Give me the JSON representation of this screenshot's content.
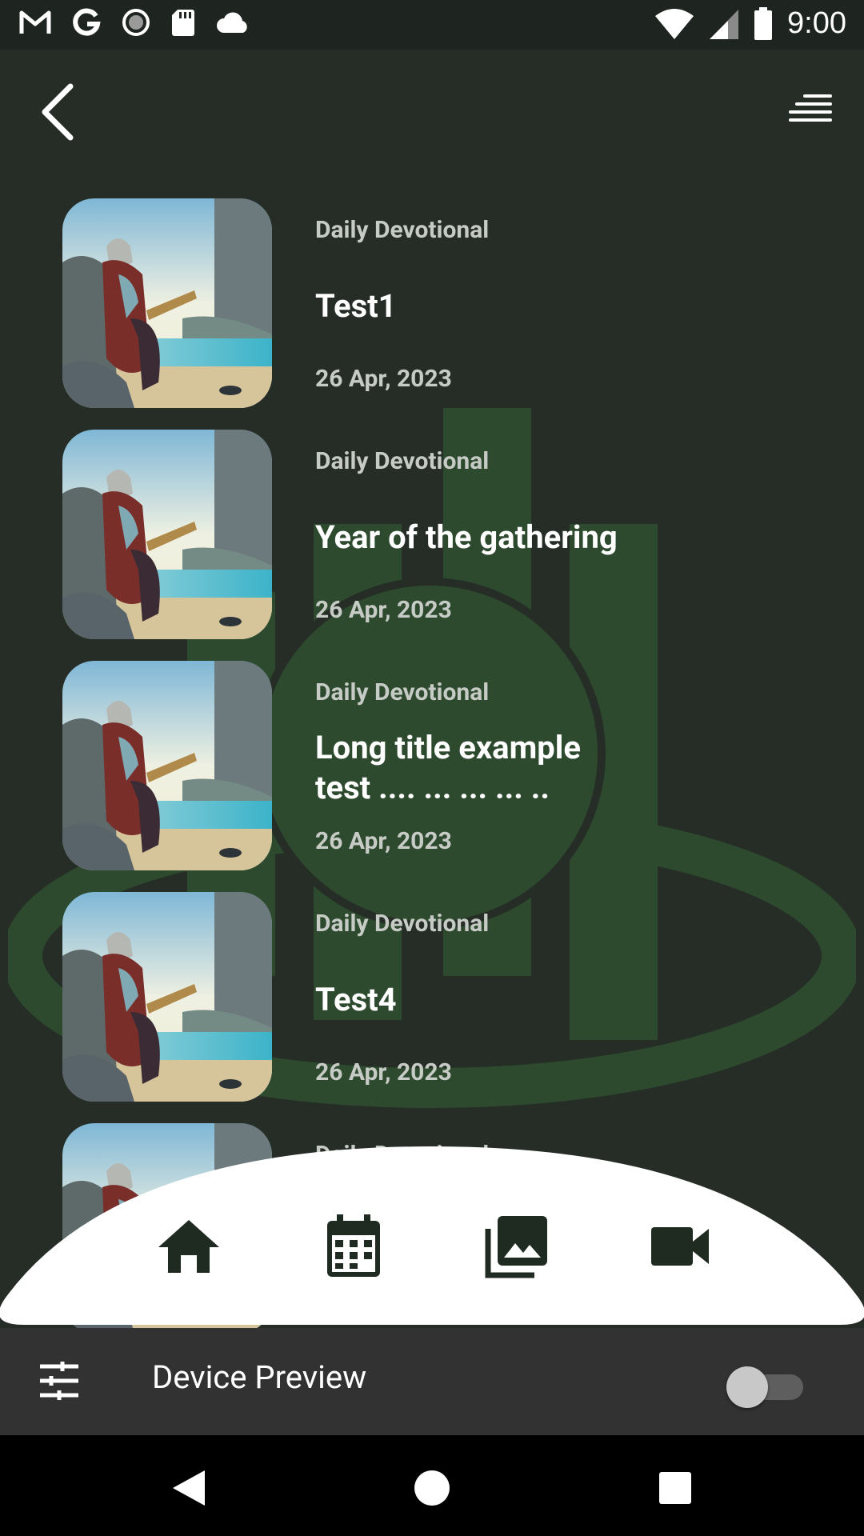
{
  "status_bar": {
    "time": "9:00",
    "left_icons": [
      "gmail-icon",
      "google-icon",
      "record-icon",
      "sd-card-icon",
      "cloud-icon"
    ],
    "right_icons": [
      "wifi-icon",
      "signal-icon",
      "battery-icon"
    ]
  },
  "header": {
    "back_icon": "chevron-left-icon",
    "menu_icon": "menu-icon"
  },
  "devotionals": [
    {
      "category": "Daily Devotional",
      "title": "Test1",
      "date": "26 Apr, 2023"
    },
    {
      "category": "Daily Devotional",
      "title": "Year of the gathering",
      "date": "26 Apr, 2023"
    },
    {
      "category": "Daily Devotional",
      "title": "Long title example test .... ... ... ... ..",
      "date": "26 Apr, 2023"
    },
    {
      "category": "Daily Devotional",
      "title": "Test4",
      "date": "26 Apr, 2023"
    },
    {
      "category": "Daily Devotional",
      "title": "",
      "date": ""
    }
  ],
  "bottom_nav": [
    "home-icon",
    "calendar-icon",
    "gallery-icon",
    "video-icon"
  ],
  "device_preview": {
    "label": "Device Preview",
    "enabled": false
  },
  "colors": {
    "background": "#252d26",
    "accent": "#2d4a2e",
    "nav_background": "#ffffff",
    "nav_icon": "#1f2a21"
  }
}
